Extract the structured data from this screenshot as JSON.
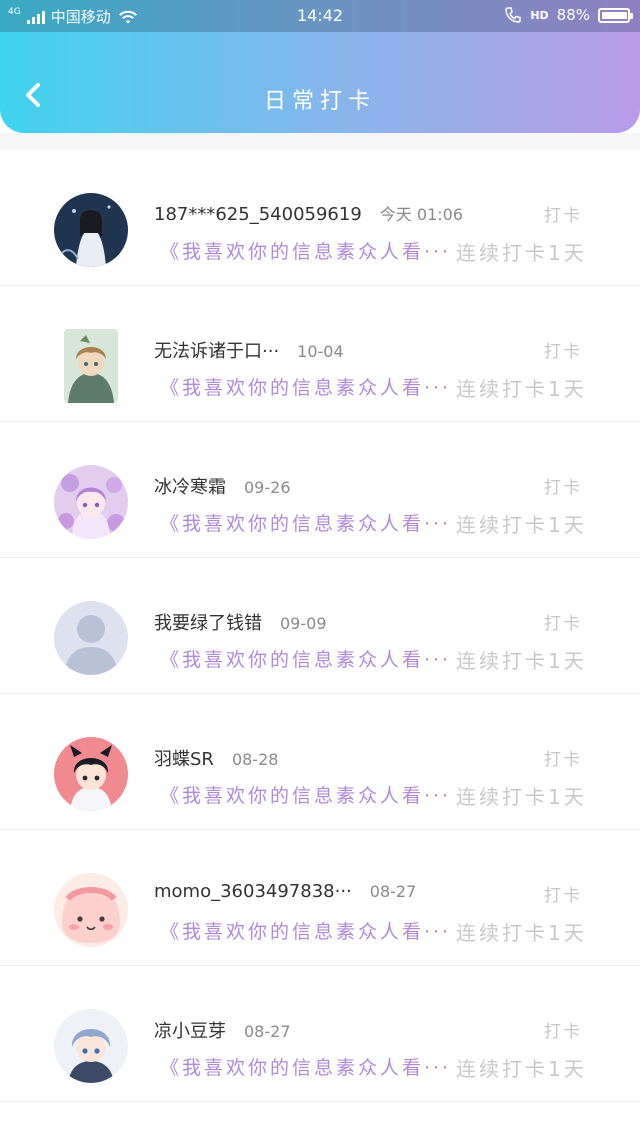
{
  "status_bar": {
    "network": "4G",
    "carrier": "中国移动",
    "time": "14:42",
    "hd": "HD",
    "battery": "88%",
    "battery_level": 0.88
  },
  "header": {
    "title": "日常打卡"
  },
  "punch_label": "打卡",
  "items": [
    {
      "name": "187***625_540059619",
      "date": "今天 01:06",
      "quote": "《我喜欢你的信息素众人看···",
      "streak": "连续打卡1天"
    },
    {
      "name": "无法诉诸于口···",
      "date": "10-04",
      "quote": "《我喜欢你的信息素众人看···",
      "streak": "连续打卡1天"
    },
    {
      "name": "冰冷寒霜",
      "date": "09-26",
      "quote": "《我喜欢你的信息素众人看···",
      "streak": "连续打卡1天"
    },
    {
      "name": "我要绿了钱错",
      "date": "09-09",
      "quote": "《我喜欢你的信息素众人看···",
      "streak": "连续打卡1天"
    },
    {
      "name": "羽蝶SR",
      "date": "08-28",
      "quote": "《我喜欢你的信息素众人看···",
      "streak": "连续打卡1天"
    },
    {
      "name": "momo_3603497838···",
      "date": "08-27",
      "quote": "《我喜欢你的信息素众人看···",
      "streak": "连续打卡1天"
    },
    {
      "name": "凉小豆芽",
      "date": "08-27",
      "quote": "《我喜欢你的信息素众人看···",
      "streak": "连续打卡1天"
    }
  ]
}
